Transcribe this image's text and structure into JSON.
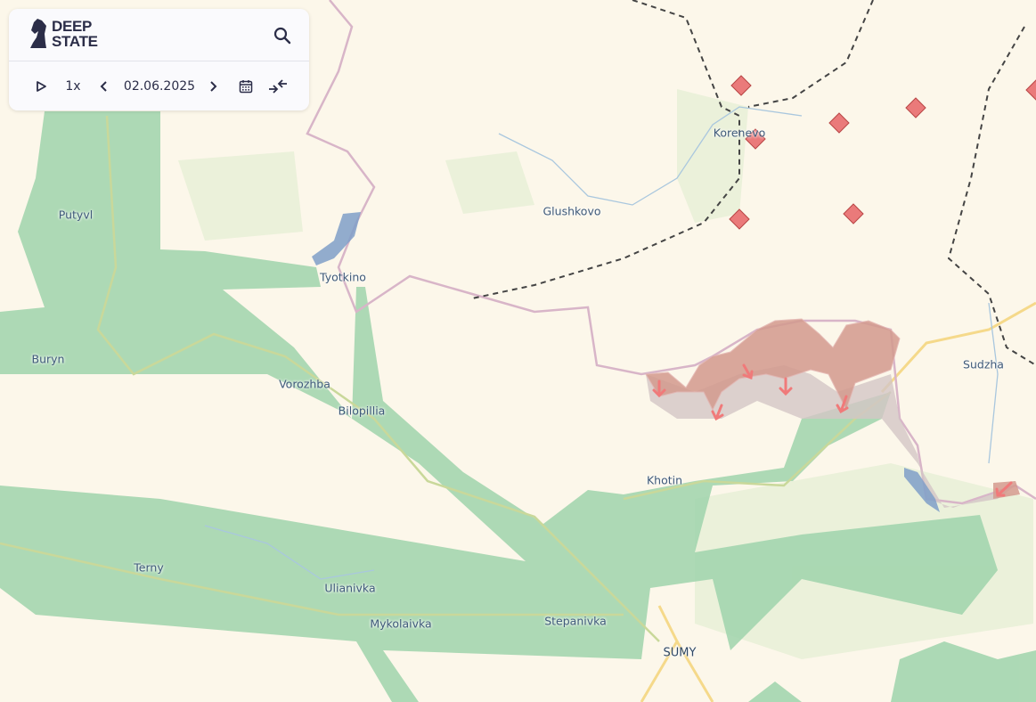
{
  "app": {
    "logo_line1": "DEEP",
    "logo_line2": "STATE"
  },
  "toolbar": {
    "play_icon": "play-icon",
    "speed": "1x",
    "prev_icon": "chevron-left-icon",
    "date": "02.06.2025",
    "next_icon": "chevron-right-icon",
    "calendar_icon": "calendar-icon",
    "collapse_icon": "collapse-arrows-icon",
    "search_icon": "search-icon"
  },
  "map": {
    "places": [
      {
        "name": "Putyvl"
      },
      {
        "name": "Buryn"
      },
      {
        "name": "Tyotkino"
      },
      {
        "name": "Glushkovo"
      },
      {
        "name": "Korenevo"
      },
      {
        "name": "Vorozhba"
      },
      {
        "name": "Bilopillia"
      },
      {
        "name": "Sudzha"
      },
      {
        "name": "Khotin"
      },
      {
        "name": "Terny"
      },
      {
        "name": "Ulianivka"
      },
      {
        "name": "Mykolaivka"
      },
      {
        "name": "Stepanivka"
      },
      {
        "name": "SUMY"
      }
    ],
    "colors": {
      "background": "#fcf7ea",
      "forest": "#a8d8b0",
      "occupied": "#d9a79a",
      "contested": "#d9cccb",
      "border": "#d8b5c8",
      "frontline_marker": "#e86a6a",
      "water": "#7f9fc8",
      "road": "#f5d98a"
    }
  }
}
